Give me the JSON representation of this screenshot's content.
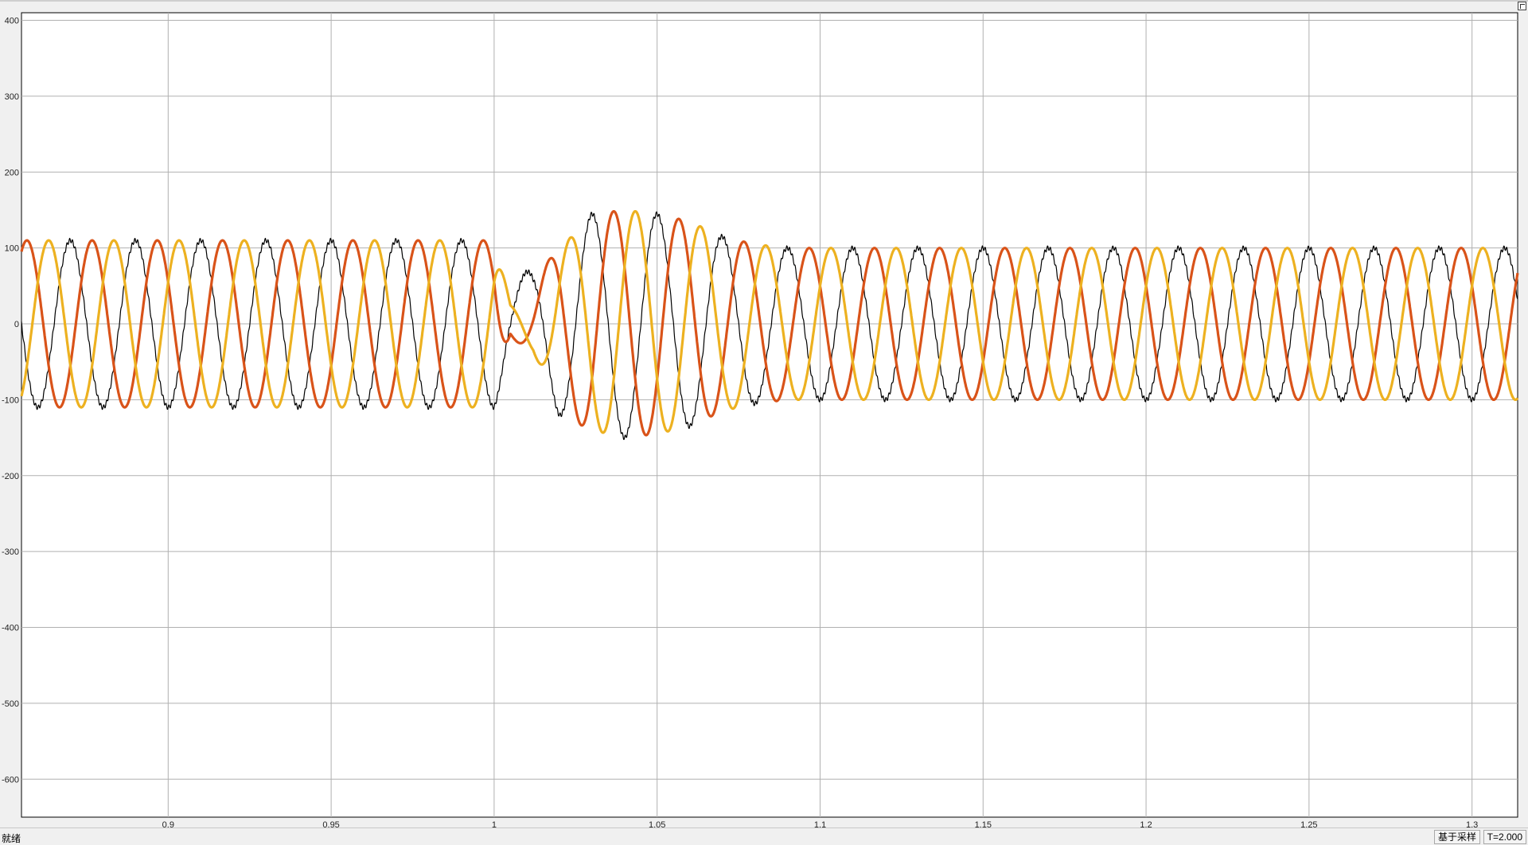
{
  "status": {
    "left_text": "就绪",
    "sample_text": "基于采样",
    "time_text": "T=2.000"
  },
  "colors": {
    "plot_background": "#ffffff",
    "frame_background": "#f0f0f0",
    "grid": "#b0b0b0",
    "phase_a": "#000000",
    "phase_b": "#d95319",
    "phase_c": "#edb120"
  },
  "chart_data": {
    "type": "line",
    "title": "",
    "xlabel": "",
    "ylabel": "",
    "grid": true,
    "legend": "none",
    "xlim": [
      0.855,
      1.314
    ],
    "ylim": [
      -650,
      410
    ],
    "x_ticks": [
      0.9,
      0.95,
      1,
      1.05,
      1.1,
      1.15,
      1.2,
      1.25,
      1.3
    ],
    "x_tick_labels": [
      "0.9",
      "0.95",
      "1",
      "1.05",
      "1.1",
      "1.15",
      "1.2",
      "1.25",
      "1.3"
    ],
    "y_ticks": [
      -600,
      -500,
      -400,
      -300,
      -200,
      -100,
      0,
      100,
      200,
      300,
      400
    ],
    "y_tick_labels": [
      "-600",
      "-500",
      "-400",
      "-300",
      "-200",
      "-100",
      "0",
      "100",
      "200",
      "300",
      "400"
    ],
    "frequency_hz": 50,
    "series": [
      {
        "color": "#000000",
        "phase_deg": -90,
        "envelope": {
          "t": [
            0.855,
            1.0,
            1.005,
            1.012,
            1.02,
            1.03,
            1.04,
            1.05,
            1.06,
            1.07,
            1.08,
            1.09,
            1.314
          ],
          "amp": [
            110,
            110,
            60,
            72,
            120,
            145,
            150,
            145,
            135,
            115,
            105,
            100,
            100
          ]
        }
      },
      {
        "color": "#d95319",
        "phase_deg": 150,
        "envelope": {
          "t": [
            0.855,
            1.0,
            1.005,
            1.012,
            1.02,
            1.03,
            1.04,
            1.05,
            1.06,
            1.07,
            1.08,
            1.09,
            1.314
          ],
          "amp": [
            110,
            110,
            15,
            45,
            110,
            145,
            150,
            145,
            135,
            115,
            105,
            100,
            100
          ]
        }
      },
      {
        "color": "#edb120",
        "phase_deg": 30,
        "envelope": {
          "t": [
            0.855,
            1.0,
            1.005,
            1.012,
            1.02,
            1.03,
            1.04,
            1.05,
            1.06,
            1.07,
            1.08,
            1.09,
            1.314
          ],
          "amp": [
            110,
            110,
            28,
            38,
            100,
            140,
            150,
            145,
            135,
            115,
            105,
            100,
            100
          ]
        }
      }
    ]
  }
}
